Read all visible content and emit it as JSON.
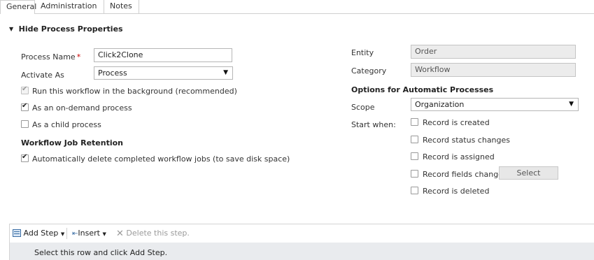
{
  "tabs": [
    {
      "label": "General",
      "active": true
    },
    {
      "label": "Administration",
      "active": false
    },
    {
      "label": "Notes",
      "active": false
    }
  ],
  "section": {
    "title": "Hide Process Properties"
  },
  "left": {
    "process_name_label": "Process Name",
    "process_name_value": "Click2Clone",
    "activate_as_label": "Activate As",
    "activate_as_value": "Process",
    "run_background_label": "Run this workflow in the background (recommended)",
    "on_demand_label": "As an on-demand process",
    "child_process_label": "As a child process",
    "retention_title": "Workflow Job Retention",
    "auto_delete_label": "Automatically delete completed workflow jobs (to save disk space)"
  },
  "right": {
    "entity_label": "Entity",
    "entity_value": "Order",
    "category_label": "Category",
    "category_value": "Workflow",
    "options_title": "Options for Automatic Processes",
    "scope_label": "Scope",
    "scope_value": "Organization",
    "start_when_label": "Start when:",
    "record_created": "Record is created",
    "record_status": "Record status changes",
    "record_assigned": "Record is assigned",
    "record_fields": "Record fields change",
    "select_button": "Select",
    "record_deleted": "Record is deleted"
  },
  "toolbar": {
    "add_step": "Add Step",
    "insert": "Insert",
    "delete_step": "Delete this step."
  },
  "steps": {
    "hint": "Select this row and click Add Step."
  },
  "colors": {
    "accent": "#cc0000",
    "steps_bg": "#e9ebee",
    "readonly_bg": "#ececec"
  }
}
